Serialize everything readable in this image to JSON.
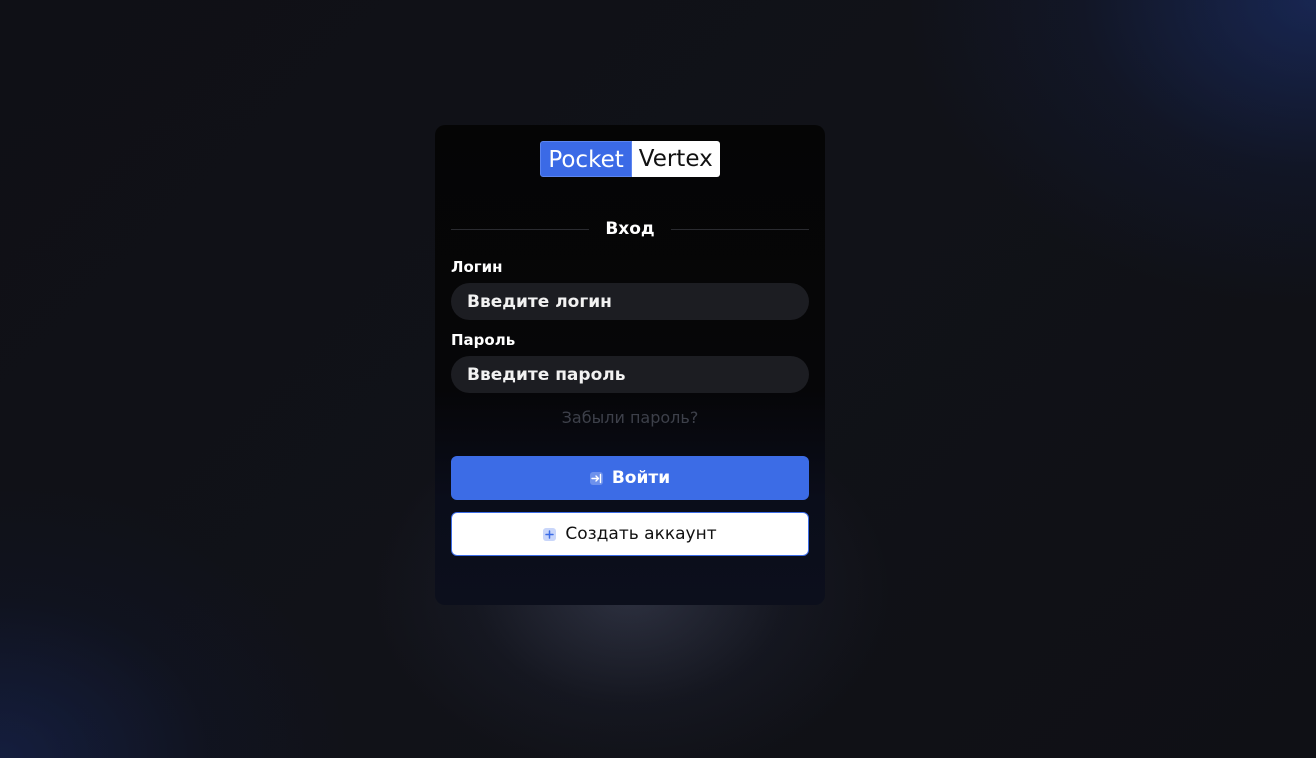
{
  "logo": {
    "part1": "Pocket",
    "part2": "Vertex"
  },
  "form": {
    "title": "Вход",
    "login_label": "Логин",
    "login_placeholder": "Введите логин",
    "password_label": "Пароль",
    "password_placeholder": "Введите пароль",
    "forgot_link": "Забыли пароль?"
  },
  "buttons": {
    "login": {
      "label": "Войти",
      "icon": "login-arrow-icon"
    },
    "create_account": {
      "label": "Создать аккаунт",
      "icon": "plus-icon"
    }
  },
  "colors": {
    "accent": "#3c6ce6",
    "card_background": "#050505",
    "input_background": "#1c1d22",
    "forgot_link": "#3d404a"
  }
}
